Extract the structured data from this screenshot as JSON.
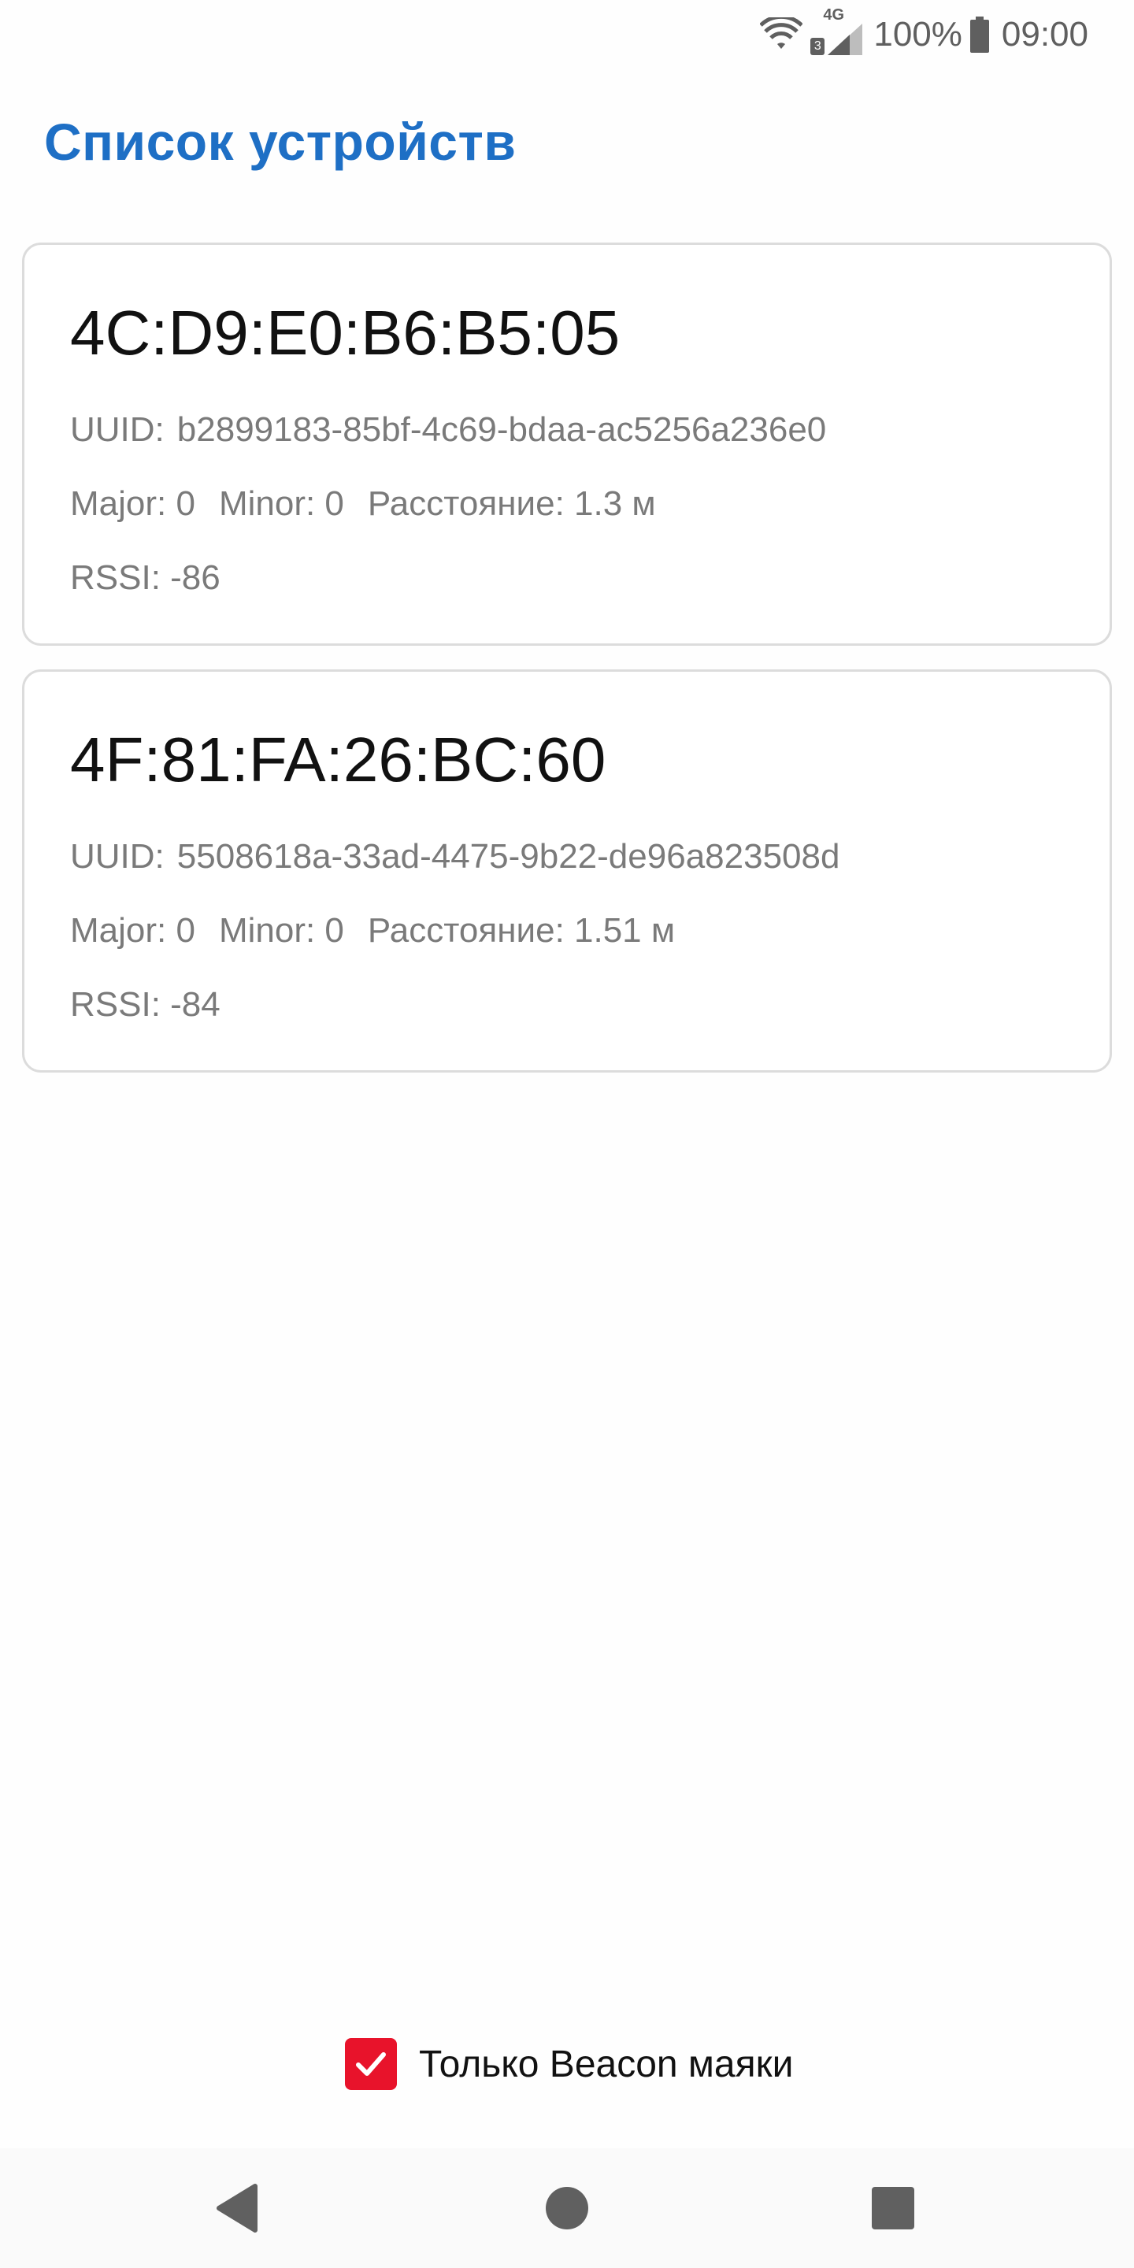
{
  "status_bar": {
    "network_type": "4G",
    "sim_label": "3",
    "battery": "100%",
    "time": "09:00",
    "icons": [
      "wifi-icon",
      "signal-icon",
      "battery-icon"
    ]
  },
  "title": "Список устройств",
  "devices": [
    {
      "mac": "4C:D9:E0:B6:B5:05",
      "uuid_label": "UUID:",
      "uuid": "b2899183-85bf-4c69-bdaa-ac5256a236e0",
      "major": "Major: 0",
      "minor": "Minor: 0",
      "distance": "Расстояние: 1.3 м",
      "rssi": "RSSI: -86"
    },
    {
      "mac": "4F:81:FA:26:BC:60",
      "uuid_label": "UUID:",
      "uuid": "5508618a-33ad-4475-9b22-de96a823508d",
      "major": "Major: 0",
      "minor": "Minor: 0",
      "distance": "Расстояние: 1.51 м",
      "rssi": "RSSI: -84"
    }
  ],
  "filter": {
    "label": "Только Beacon маяки",
    "checked": true
  },
  "nav": {
    "icons": [
      "back-icon",
      "home-icon",
      "recents-icon"
    ]
  },
  "colors": {
    "title": "#1e6fc5",
    "checkbox": "#e8132b",
    "secondary_text": "#7a7a7a"
  }
}
